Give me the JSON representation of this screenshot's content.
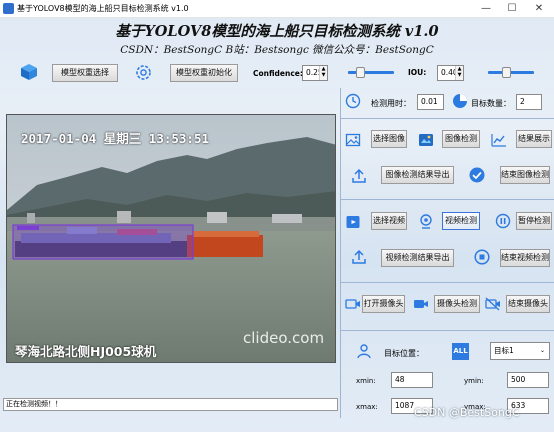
{
  "window": {
    "title": "基于YOLOV8模型的海上船只目标检测系统 v1.0",
    "minimize": "—",
    "maximize": "☐",
    "close": "✕"
  },
  "header": {
    "title": "基于YOLOV8模型的海上船只目标检测系统 v1.0",
    "subtitle": "CSDN：BestSongC   B站：Bestsongc   微信公众号：BestSongC"
  },
  "model": {
    "select_label": "模型权重选择",
    "init_label": "模型权重初始化",
    "confidence_label": "Confidence:",
    "confidence_value": "0.25",
    "confidence_level": 0.25,
    "iou_label": "IOU:",
    "iou_value": "0.40",
    "iou_level": 0.4
  },
  "stats": {
    "time_label": "检测用时：",
    "time_value": "0.01",
    "count_label": "目标数量：",
    "count_value": "2"
  },
  "image_ctrl": {
    "select": "选择图像",
    "detect": "图像检测",
    "show": "结果展示",
    "export": "图像检测结果导出",
    "end": "结束图像检测"
  },
  "video_ctrl": {
    "select": "选择视频",
    "detect": "视频检测",
    "pause": "暂停检测",
    "export": "视频检测结果导出",
    "end": "结束视频检测"
  },
  "camera_ctrl": {
    "open": "打开摄像头",
    "detect": "摄像头检测",
    "end": "结束摄像头"
  },
  "target": {
    "position_label": "目标位置：",
    "all_badge": "ALL",
    "selected": "目标1",
    "xmin_label": "xmin:",
    "xmin_value": "48",
    "ymin_label": "ymin:",
    "ymin_value": "500",
    "xmax_label": "xmax:",
    "xmax_value": "1087",
    "ymax_label": "ymax:",
    "ymax_value": "633"
  },
  "video": {
    "timestamp": "2017-01-04  星期三  13:53:51",
    "watermark": "clideo.com",
    "location": "琴海北路北侧HJ005球机"
  },
  "status": {
    "text": "正在检测视频！！"
  },
  "footer_watermark": "CSDN @BestSongC",
  "colors": {
    "accent": "#2d7be0",
    "detect_box": "#7b3fd1"
  }
}
